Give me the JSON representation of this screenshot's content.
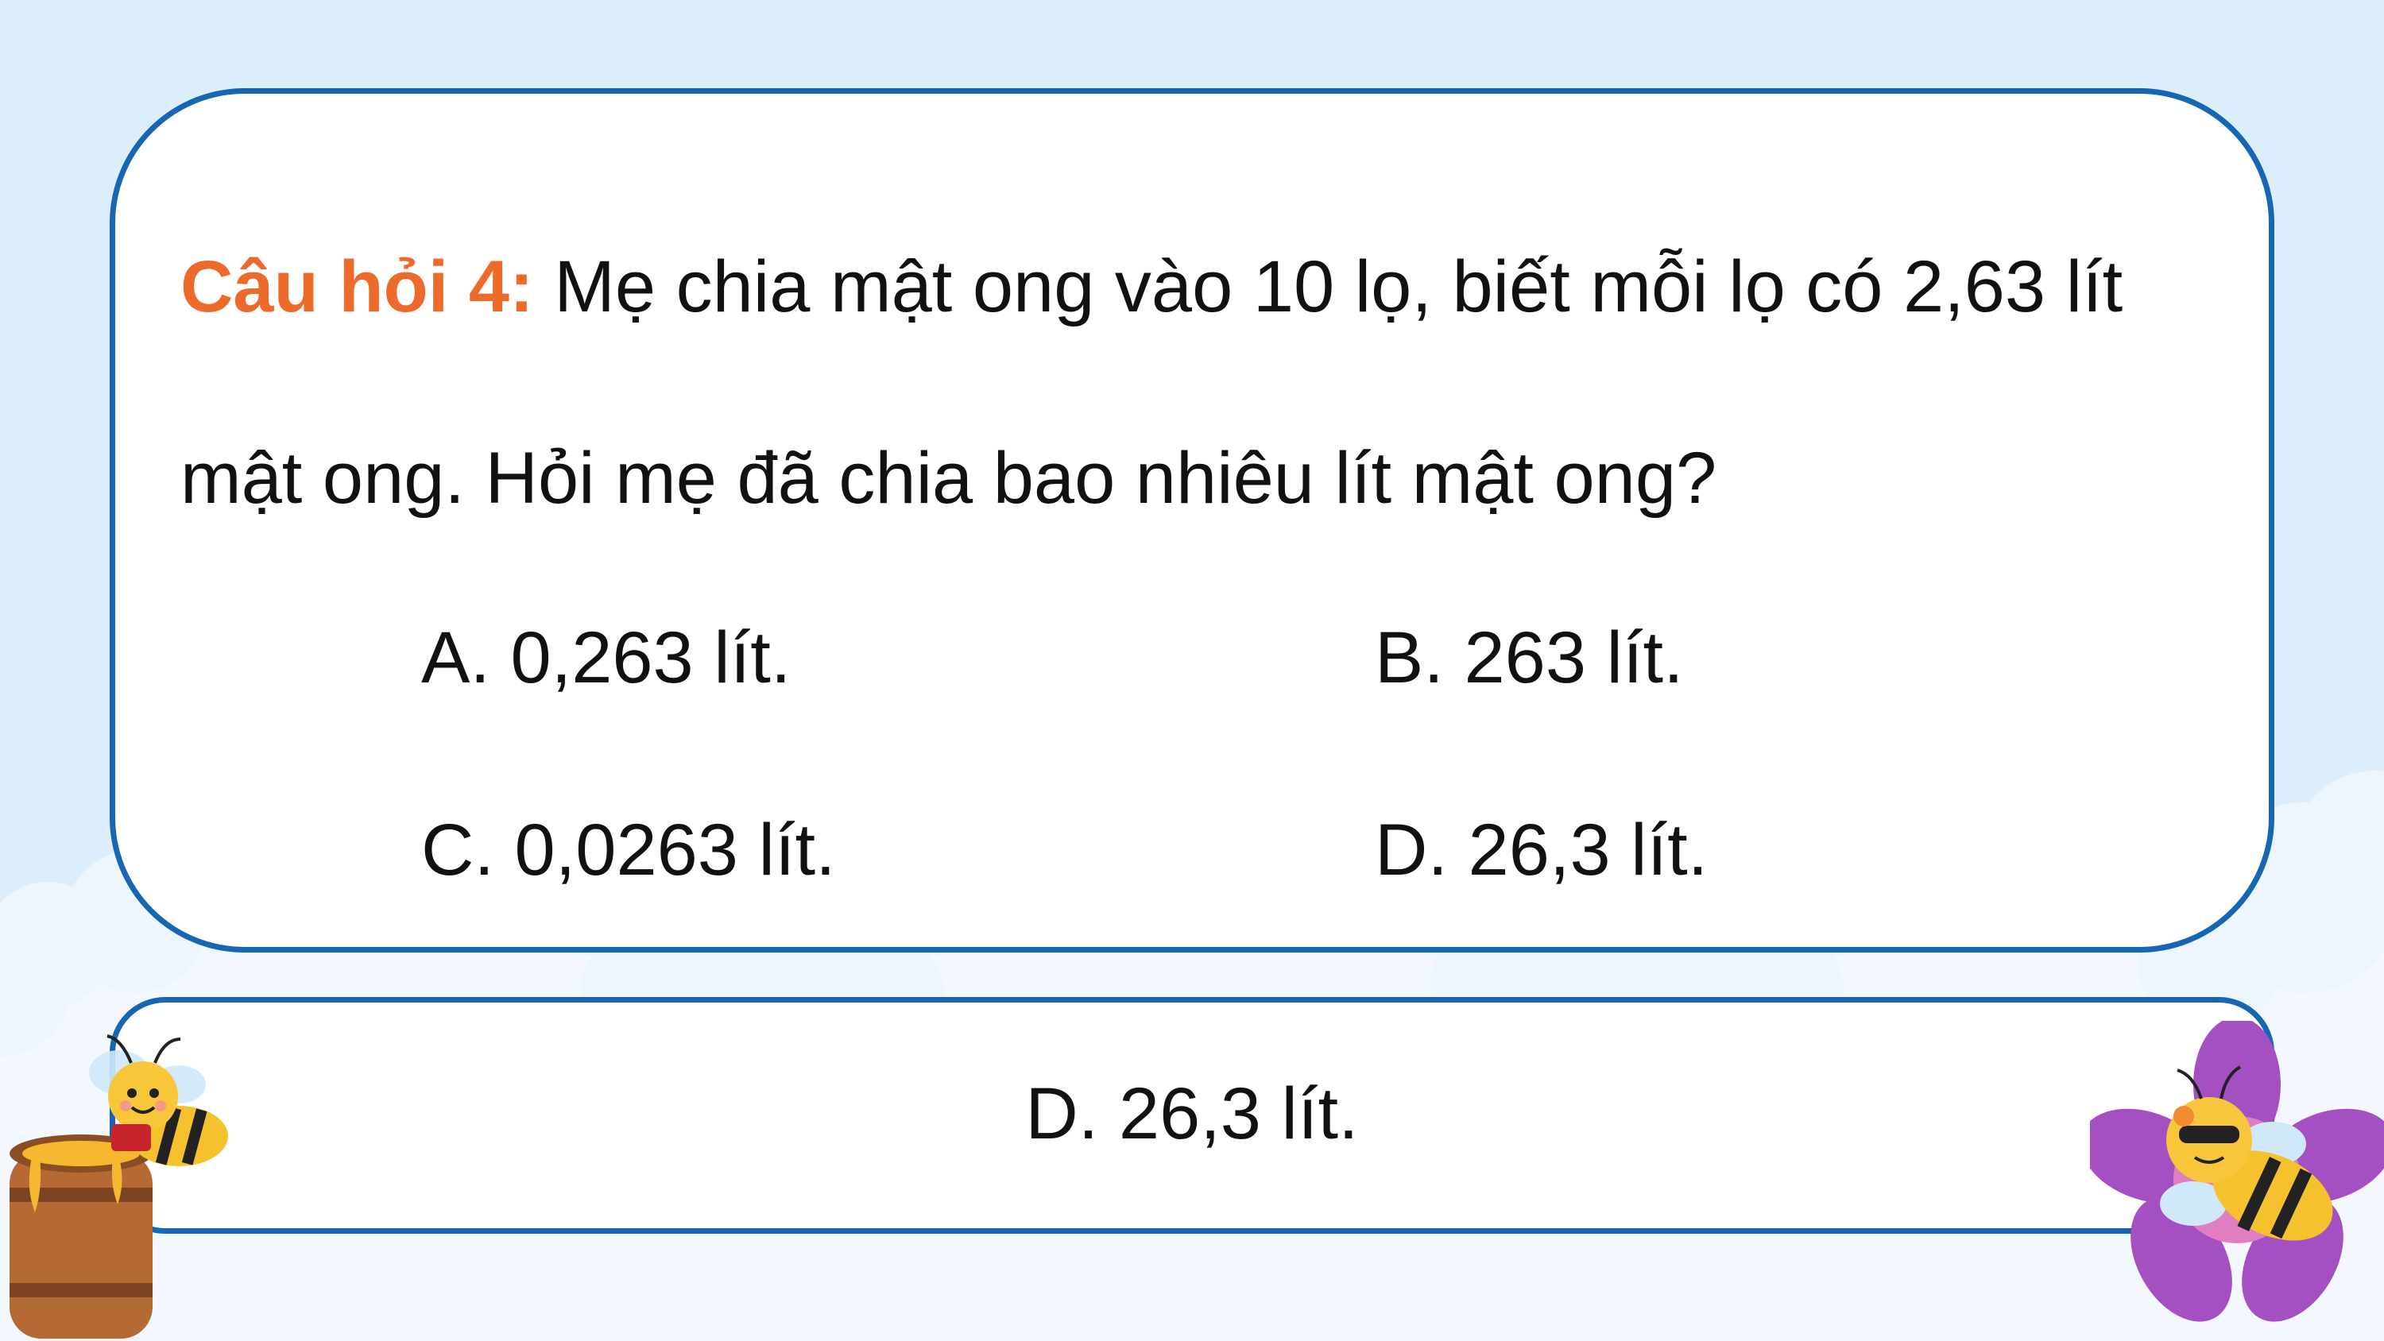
{
  "question": {
    "label": "Câu hỏi 4:",
    "text": " Mẹ chia mật ong vào 10 lọ, biết mỗi lọ có 2,63 lít mật ong. Hỏi mẹ đã chia bao nhiêu lít mật ong?"
  },
  "options": {
    "a": "A. 0,263 lít.",
    "b": "B. 263 lít.",
    "c": "C. 0,0263 lít.",
    "d": "D. 26,3 lít."
  },
  "answer": "D. 26,3 lít.",
  "colors": {
    "background": "#dcedfb",
    "border": "#1766b3",
    "label": "#ec6a2a",
    "honey": "#f5b82e",
    "barrel": "#b46a32",
    "flower": "#a44fc2"
  },
  "icons": {
    "left": [
      "bee-icon",
      "honey-barrel-icon"
    ],
    "right": [
      "flower-icon",
      "sleeping-bee-icon"
    ]
  }
}
